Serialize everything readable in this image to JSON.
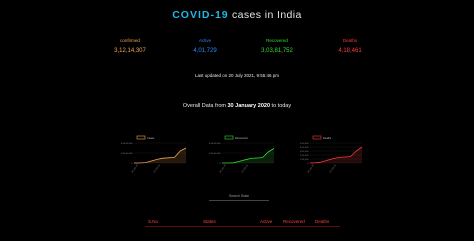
{
  "header": {
    "title_accent": "COVID-19",
    "title_rest": "cases in India"
  },
  "stats": {
    "confirmed": {
      "label": "confirmed",
      "value": "3,12,14,307",
      "color": "#f0a552"
    },
    "active": {
      "label": "Active",
      "value": "4,01,729",
      "color": "#2e88ff"
    },
    "recovered": {
      "label": "Recovered",
      "value": "3,03,81,752",
      "color": "#33dd33"
    },
    "deaths": {
      "label": "Deaths",
      "value": "4,18,461",
      "color": "#ff3a3a"
    }
  },
  "last_updated": "Last updated on 20 July 2021, 9:55:46 pm",
  "overall": {
    "prefix": "Overall Data from",
    "date": "30 January 2020",
    "suffix": "to today"
  },
  "charts": [
    {
      "legend": "Cases",
      "color": "#f0a552",
      "y_ticks": [
        "4,00,00,000",
        "2,00,00,000",
        "0"
      ],
      "x_ticks": [
        "30 Jan 20",
        "14 Jan 21"
      ],
      "values": [
        0,
        0,
        0.02,
        0.1,
        0.18,
        0.24,
        0.26,
        0.28,
        0.6,
        0.75
      ]
    },
    {
      "legend": "Recovered",
      "color": "#33dd33",
      "y_ticks": [
        "4,00,00,000",
        "2,00,00,000",
        "0"
      ],
      "x_ticks": [
        "30 Jan 20",
        "14 Jan 21"
      ],
      "values": [
        0,
        0,
        0.01,
        0.08,
        0.16,
        0.23,
        0.25,
        0.27,
        0.55,
        0.73
      ]
    },
    {
      "legend": "Deaths",
      "color": "#ff3a3a",
      "y_ticks": [
        "5,00,000",
        "4,00,000",
        "3,00,000",
        "2,00,000",
        "1,00,000",
        "0"
      ],
      "x_ticks": [
        "30 Jan 20",
        "14 Jan 21"
      ],
      "values": [
        0,
        0.01,
        0.05,
        0.14,
        0.22,
        0.28,
        0.3,
        0.32,
        0.6,
        0.8
      ]
    }
  ],
  "search": {
    "placeholder": "Search State"
  },
  "table": {
    "headers": [
      "S.No",
      "States",
      "Active",
      "Recovered",
      "Deaths"
    ]
  }
}
